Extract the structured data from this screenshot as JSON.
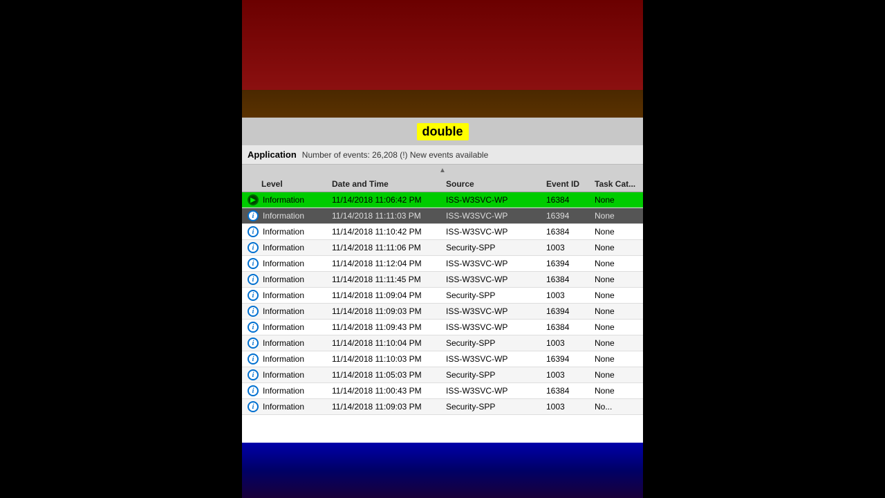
{
  "ui": {
    "double_label": "double",
    "app_name": "Application",
    "event_count": "Number of events: 26,208 (!) New events available",
    "columns": {
      "level": "Level",
      "datetime": "Date and Time",
      "source": "Source",
      "eventid": "Event ID",
      "taskcat": "Task Cat..."
    },
    "rows": [
      {
        "level": "Information",
        "datetime": "11/14/2018 11:06:42 PM",
        "source": "ISS-W3SVC-WP",
        "eventid": "16384",
        "taskcat": "None",
        "selected": true,
        "icon": "arrow"
      },
      {
        "level": "Information",
        "datetime": "11/14/2018 11:11:03 PM",
        "source": "ISS-W3SVC-WP",
        "eventid": "16394",
        "taskcat": "None",
        "selected": false,
        "partial": true,
        "icon": "info"
      },
      {
        "level": "Information",
        "datetime": "11/14/2018 11:10:42 PM",
        "source": "ISS-W3SVC-WP",
        "eventid": "16384",
        "taskcat": "None",
        "selected": false,
        "icon": "info"
      },
      {
        "level": "Information",
        "datetime": "11/14/2018 11:11:06 PM",
        "source": "Security-SPP",
        "eventid": "1003",
        "taskcat": "None",
        "selected": false,
        "icon": "info"
      },
      {
        "level": "Information",
        "datetime": "11/14/2018 11:12:04 PM",
        "source": "ISS-W3SVC-WP",
        "eventid": "16394",
        "taskcat": "None",
        "selected": false,
        "icon": "info"
      },
      {
        "level": "Information",
        "datetime": "11/14/2018 11:11:45 PM",
        "source": "ISS-W3SVC-WP",
        "eventid": "16384",
        "taskcat": "None",
        "selected": false,
        "icon": "info"
      },
      {
        "level": "Information",
        "datetime": "11/14/2018 11:09:04 PM",
        "source": "Security-SPP",
        "eventid": "1003",
        "taskcat": "None",
        "selected": false,
        "icon": "info"
      },
      {
        "level": "Information",
        "datetime": "11/14/2018 11:09:03 PM",
        "source": "ISS-W3SVC-WP",
        "eventid": "16394",
        "taskcat": "None",
        "selected": false,
        "icon": "info"
      },
      {
        "level": "Information",
        "datetime": "11/14/2018 11:09:43 PM",
        "source": "ISS-W3SVC-WP",
        "eventid": "16384",
        "taskcat": "None",
        "selected": false,
        "icon": "info"
      },
      {
        "level": "Information",
        "datetime": "11/14/2018 11:10:04 PM",
        "source": "Security-SPP",
        "eventid": "1003",
        "taskcat": "None",
        "selected": false,
        "icon": "info"
      },
      {
        "level": "Information",
        "datetime": "11/14/2018 11:10:03 PM",
        "source": "ISS-W3SVC-WP",
        "eventid": "16394",
        "taskcat": "None",
        "selected": false,
        "icon": "info"
      },
      {
        "level": "Information",
        "datetime": "11/14/2018 11:05:03 PM",
        "source": "Security-SPP",
        "eventid": "1003",
        "taskcat": "None",
        "selected": false,
        "icon": "info"
      },
      {
        "level": "Information",
        "datetime": "11/14/2018 11:00:43 PM",
        "source": "ISS-W3SVC-WP",
        "eventid": "16384",
        "taskcat": "None",
        "selected": false,
        "icon": "info"
      },
      {
        "level": "Information",
        "datetime": "11/14/2018 11:09:03 PM",
        "source": "Security-SPP",
        "eventid": "1003",
        "taskcat": "No...",
        "selected": false,
        "partial_bottom": true,
        "icon": "info"
      }
    ]
  }
}
